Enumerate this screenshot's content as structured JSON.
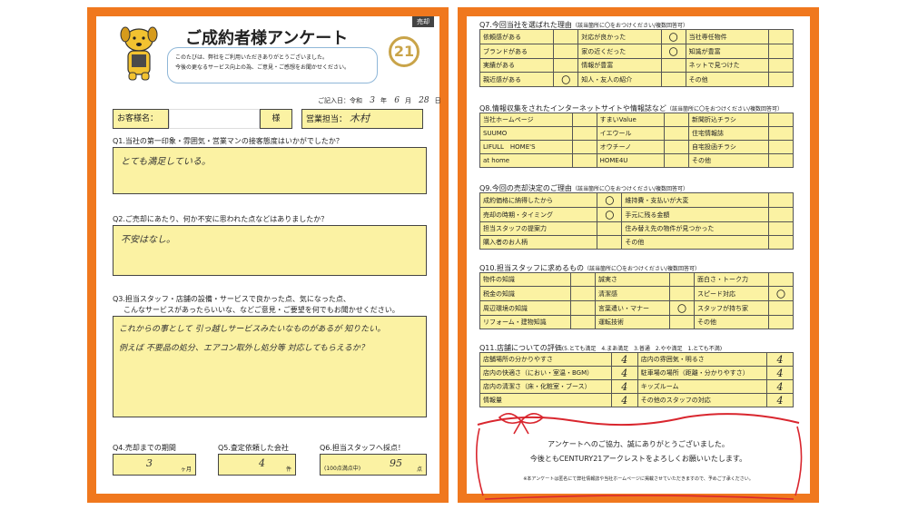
{
  "badge": "売却",
  "title": "ご成約者様アンケート",
  "intro_line1": "このたびは、弊社をご利用いただきありがとうございました。",
  "intro_line2": "今後の更なるサービス向上の為、ご意見・ご感想をお聞かせください。",
  "logo_text": "21",
  "date_label": "ご記入日：令和",
  "date_year": "3",
  "date_month": "6",
  "date_day": "28",
  "date_suffix_year": "年",
  "date_suffix_month": "月",
  "date_suffix_day": "日",
  "customer_label": "お客様名：",
  "customer_suffix": "様",
  "sales_label": "営業担当：",
  "sales_name": "木村",
  "q1": {
    "label": "Q1.当社の第一印象・雰囲気・営業マンの接客態度はいかがでしたか？",
    "answer": "とても満足している。"
  },
  "q2": {
    "label": "Q2.ご売却にあたり、何か不安に思われた点などはありましたか？",
    "answer": "不安はなし。"
  },
  "q3": {
    "label1": "Q3.担当スタッフ・店舗の設備・サービスで良かった点、気になった点、",
    "label2": "こんなサービスがあったらいいな、などご意見・ご要望を何でもお聞かせください。",
    "answer1": "これからの事として 引っ越しサービスみたいなものがあるが 知りたい。",
    "answer2": "例えば 不要品の処分、エアコン取外し処分等 対応してもらえるか？"
  },
  "q4": {
    "label": "Q4.売却までの期間",
    "value": "3",
    "unit": "ヶ月"
  },
  "q5": {
    "label": "Q5.査定依頼した会社",
    "value": "4",
    "unit": "件"
  },
  "q6": {
    "label": "Q6.担当スタッフへ採点！",
    "prefix": "(100点満点中)",
    "value": "95",
    "unit": "点"
  },
  "q7": {
    "label": "Q7.今回当社を選ばれた理由",
    "note": "（該当箇所に〇をおつけください/複数回答可）",
    "rows": [
      [
        "依頼感がある",
        "",
        "対応が良かった",
        "〇",
        "当社専任物件",
        ""
      ],
      [
        "ブランドがある",
        "",
        "家の近くだった",
        "〇",
        "知識が豊富",
        ""
      ],
      [
        "実績がある",
        "",
        "情報が豊富",
        "",
        "ネットで見つけた",
        ""
      ],
      [
        "親近感がある",
        "〇",
        "知人・友人の紹介",
        "",
        "その他",
        ""
      ]
    ]
  },
  "q8": {
    "label": "Q8.情報収集をされたインターネットサイトや情報誌など",
    "note": "（該当箇所に〇をおつけください/複数回答可）",
    "rows": [
      [
        "当社ホームページ",
        "",
        "すまいValue",
        "",
        "新聞折込チラシ",
        ""
      ],
      [
        "SUUMO",
        "",
        "イエウール",
        "",
        "住宅情報誌",
        ""
      ],
      [
        "LIFULL　HOME'S",
        "",
        "オウチーノ",
        "",
        "自宅投函チラシ",
        ""
      ],
      [
        "at home",
        "",
        "HOME4U",
        "",
        "その他",
        ""
      ]
    ]
  },
  "q9": {
    "label": "Q9.今回の売却決定のご理由",
    "note": "（該当箇所に〇をおつけください/複数回答可）",
    "rows": [
      [
        "成約価格に納得したから",
        "〇",
        "維持費・支払いが大変",
        ""
      ],
      [
        "売却の時期・タイミング",
        "〇",
        "手元に残る金額",
        ""
      ],
      [
        "担当スタッフの提案力",
        "",
        "住み替え先の物件が見つかった",
        ""
      ],
      [
        "購入者のお人柄",
        "",
        "その他",
        ""
      ]
    ]
  },
  "q10": {
    "label": "Q10.担当スタッフに求めるもの",
    "note": "（該当箇所に〇をおつけください/複数回答可）",
    "rows": [
      [
        "物件の知識",
        "",
        "誠実さ",
        "",
        "面白さ・トーク力",
        ""
      ],
      [
        "税金の知識",
        "",
        "清潔感",
        "",
        "スピード対応",
        "〇"
      ],
      [
        "周辺環境の知識",
        "",
        "言葉遣い・マナー",
        "〇",
        "スタッフが持ち家",
        ""
      ],
      [
        "リフォーム・建物知識",
        "",
        "運転技術",
        "",
        "その他",
        ""
      ]
    ]
  },
  "q11": {
    "label": "Q11.店舗についての評価",
    "scale": "(5.とても満足　4.まあ満足　3.普通　2.やや満足　1.とても不満)",
    "rows": [
      [
        "店舗場所の分かりやすさ",
        "4",
        "店内の雰囲気・明るさ",
        "4"
      ],
      [
        "店内の快適さ（におい・室温・BGM）",
        "4",
        "駐車場の場所（距離・分かりやすさ）",
        "4"
      ],
      [
        "店内の清潔さ（床・化粧室・ブース）",
        "4",
        "キッズルーム",
        "4"
      ],
      [
        "情報量",
        "4",
        "その他のスタッフの対応",
        "4"
      ]
    ]
  },
  "thanks_line1": "アンケートへのご協力、誠にありがとうございました。",
  "thanks_line2": "今後ともCENTURY21アークレストをよろしくお願いいたします。",
  "footnote": "※本アンケートは匿名にて弊社情報誌や当社ホームページに掲載させていただきますので、予めご了承ください。",
  "colors": {
    "frame": "#f0781e",
    "field": "#fbf2a3",
    "ribbon": "#d9262e"
  }
}
